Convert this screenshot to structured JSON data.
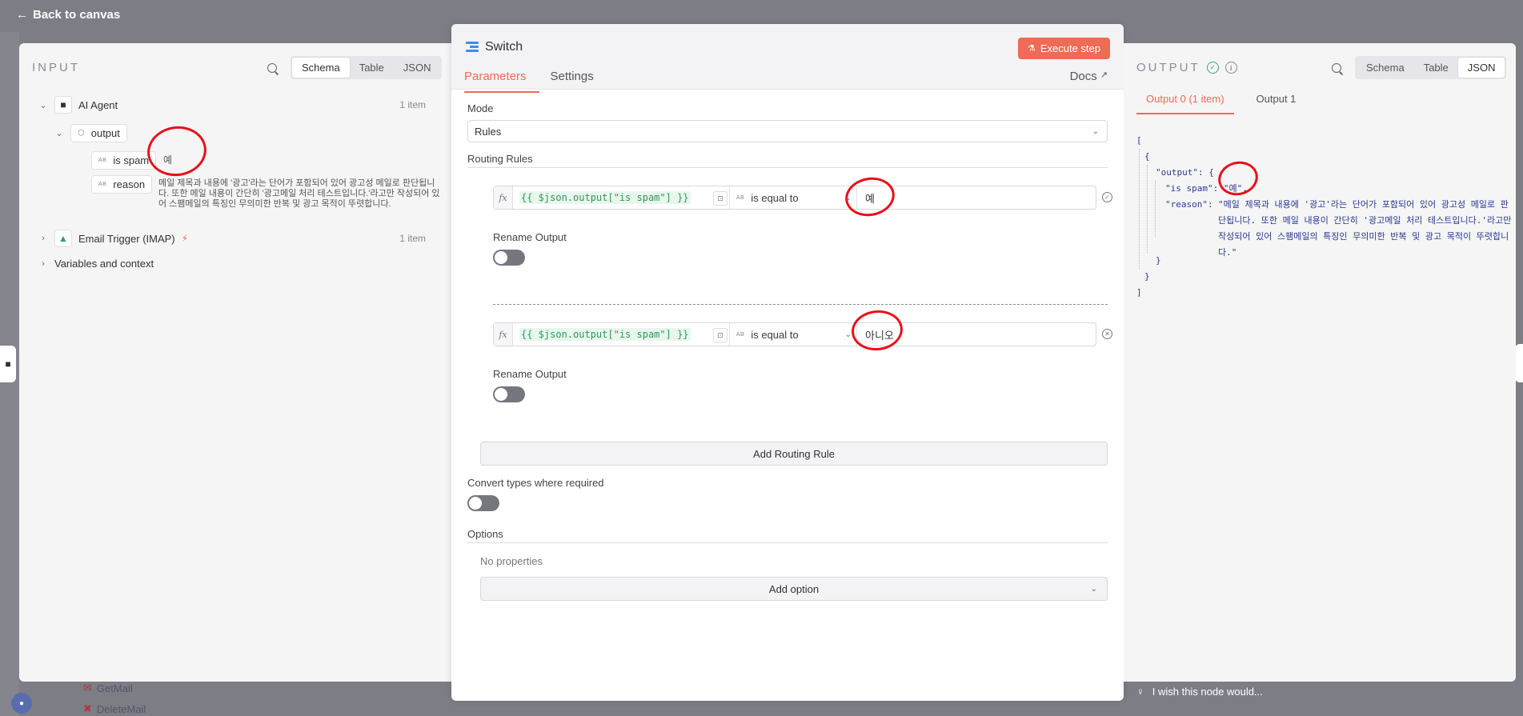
{
  "topbar": {
    "back_label": "Back to canvas"
  },
  "backdrop": {
    "bottom_items": [
      "GetMail",
      "DeleteMail"
    ]
  },
  "input": {
    "title": "INPUT",
    "tabs": [
      "Schema",
      "Table",
      "JSON"
    ],
    "active_tab": "Schema",
    "ai_agent": {
      "label": "AI Agent",
      "count": "1 item"
    },
    "output_label": "output",
    "fields": [
      {
        "type": "AB",
        "name": "is spam",
        "value": "예"
      },
      {
        "type": "AB",
        "name": "reason",
        "value": "메일 제목과 내용에 '광고'라는 단어가 포함되어 있어 광고성 메일로 판단됩니다. 또한 메일 내용이 간단히 '광고메일 처리 테스트입니다.'라고만 작성되어 있어 스팸메일의 특징인 무의미한 반복 및 광고 목적이 뚜렷합니다."
      }
    ],
    "email_trigger": {
      "label": "Email Trigger (IMAP)",
      "count": "1 item"
    },
    "variables_label": "Variables and context"
  },
  "node": {
    "title": "Switch",
    "execute_label": "Execute step",
    "tabs": [
      "Parameters",
      "Settings"
    ],
    "active_tab": "Parameters",
    "docs_label": "Docs",
    "mode_label": "Mode",
    "mode_value": "Rules",
    "routing_label": "Routing Rules",
    "rules": [
      {
        "expression": "{{ $json.output[\"is spam\"] }}",
        "type": "AB",
        "operator": "is equal to",
        "value": "예",
        "rename_label": "Rename Output"
      },
      {
        "expression": "{{ $json.output[\"is spam\"] }}",
        "type": "AB",
        "operator": "is equal to",
        "value": "아니오",
        "rename_label": "Rename Output"
      }
    ],
    "add_rule_label": "Add Routing Rule",
    "convert_label": "Convert types where required",
    "options_label": "Options",
    "no_properties": "No properties",
    "add_option_label": "Add option"
  },
  "output": {
    "title": "OUTPUT",
    "tabs": [
      "Schema",
      "Table",
      "JSON"
    ],
    "active_tab": "JSON",
    "output_tabs": [
      "Output 0 (1 item)",
      "Output 1"
    ],
    "json_lines": {
      "open_bracket": "[",
      "open_brace": "{",
      "output_key": "\"output\": {",
      "is_spam": "\"is spam\": \"예\",",
      "reason_key": "\"reason\":",
      "reason_value": "\"메일 제목과 내용에 '광고'라는 단어가 포함되어 있어 광고성 메일로 판단됩니다. 또한 메일 내용이 간단히 '광고메일 처리 테스트입니다.'라고만 작성되어 있어 스팸메일의 특징인 무의미한 반복 및 광고 목적이 뚜렷합니다.\"",
      "close_inner": "}",
      "close_brace": "}",
      "close_bracket": "]"
    },
    "feedback": "I wish this node would..."
  },
  "colors": {
    "accent": "#ee6b55",
    "success": "#39a969",
    "expression": "#2e9a54",
    "annotation": "#e8101a"
  }
}
